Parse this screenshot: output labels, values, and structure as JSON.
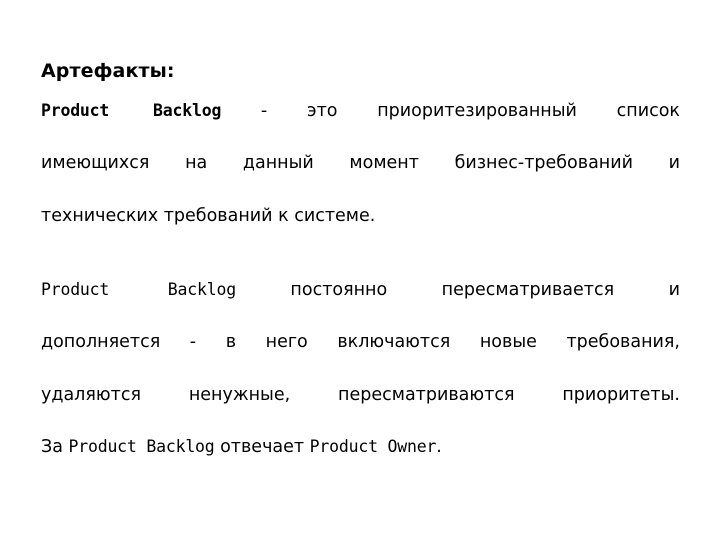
{
  "slide": {
    "background_color": "#ffffff",
    "text_color": "#000000",
    "heading": "Артефакты:",
    "paragraphs": [
      {
        "id": "product-backlog-definition",
        "lines": [
          {
            "segments": [
              {
                "text": "Product Backlog",
                "style": "term-bold"
              },
              {
                "text": " - это приоритезированный список",
                "style": "plain"
              }
            ]
          },
          {
            "segments": [
              {
                "text": "имеющихся на данный момент бизнес-требований и",
                "style": "plain"
              }
            ]
          },
          {
            "segments": [
              {
                "text": "технических требований к системе.",
                "style": "plain"
              }
            ]
          }
        ],
        "plain_text": "Product Backlog - это приоритезированный список имеющихся на данный момент бизнес-требований и технических требований к системе."
      },
      {
        "id": "product-backlog-maintenance",
        "lines": [
          {
            "segments": [
              {
                "text": "Product Backlog",
                "style": "term"
              },
              {
                "text": " постоянно пересматривается и",
                "style": "plain"
              }
            ]
          },
          {
            "segments": [
              {
                "text": "дополняется - в него включаются новые требования,",
                "style": "plain"
              }
            ]
          },
          {
            "segments": [
              {
                "text": "удаляются ненужные, пересматриваются приоритеты.",
                "style": "plain"
              }
            ]
          },
          {
            "segments": [
              {
                "text": "За ",
                "style": "plain"
              },
              {
                "text": "Product Backlog",
                "style": "term"
              },
              {
                "text": " отвечает ",
                "style": "plain"
              },
              {
                "text": "Product Owner",
                "style": "term"
              },
              {
                "text": ".",
                "style": "plain"
              }
            ]
          }
        ],
        "plain_text": "Product Backlog постоянно пересматривается и дополняется - в него включаются новые требования, удаляются ненужные, пересматриваются приоритеты. За Product Backlog отвечает Product Owner."
      }
    ]
  }
}
